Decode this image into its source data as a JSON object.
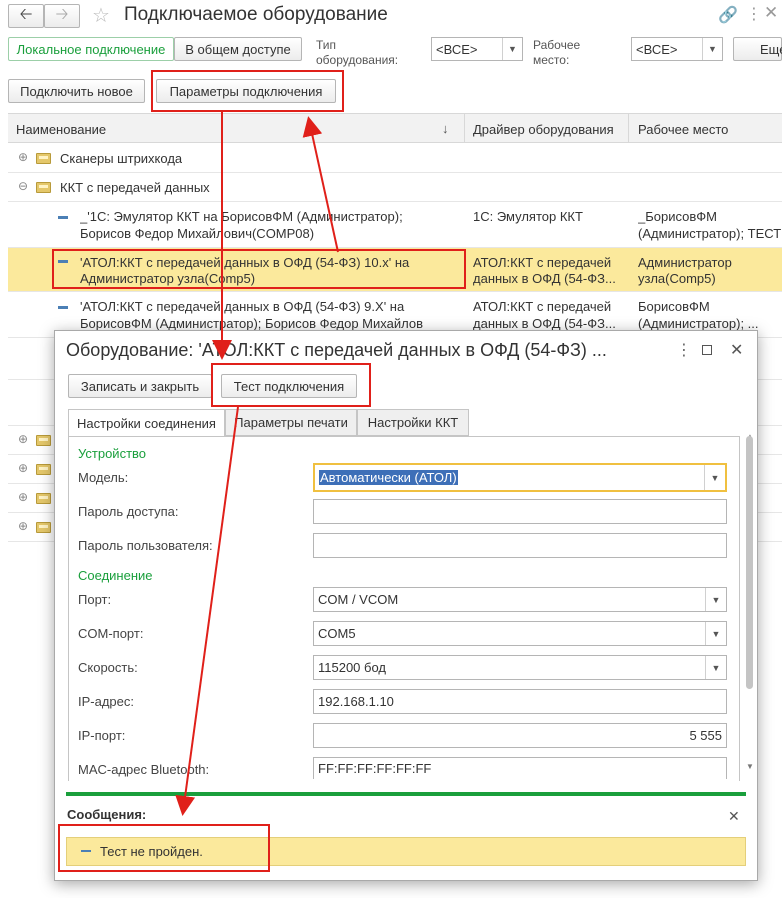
{
  "window": {
    "title": "Подключаемое оборудование"
  },
  "filters": {
    "local_label": "Локальное подключение",
    "shared_label": "В общем доступе",
    "equip_type_label": "Тип оборудования:",
    "equip_type_value": "<ВСЕ>",
    "workplace_label": "Рабочее место:",
    "workplace_value": "<ВСЕ>",
    "more_label": "Еще"
  },
  "toolbar": {
    "connect_new": "Подключить новое",
    "conn_params": "Параметры подключения"
  },
  "grid": {
    "columns": [
      "Наименование",
      "Драйвер оборудования",
      "Рабочее место"
    ],
    "sort_indicator": "↓",
    "groups": [
      {
        "label": "Сканеры штрихкода"
      },
      {
        "label": "ККТ с передачей данных"
      }
    ],
    "rows": [
      {
        "name1": "_'1С: Эмулятор ККТ на БорисовФМ (Администратор);",
        "name2": "Борисов Федор Михайлович(COMP08)",
        "driver1": "1С: Эмулятор ККТ",
        "driver2": "",
        "wp1": "_БорисовФМ",
        "wp2": "(Администратор); ТЕСТ"
      },
      {
        "name1": "'АТОЛ:ККТ с передачей данных в ОФД (54-ФЗ) 10.x' на",
        "name2": "Администратор узла(Comp5)",
        "driver1": "АТОЛ:ККТ с передачей",
        "driver2": "данных в ОФД (54-ФЗ...",
        "wp1": "Администратор",
        "wp2": "узла(Comp5)"
      },
      {
        "name1": "'АТОЛ:ККТ с передачей данных в ОФД (54-ФЗ) 9.X' на",
        "name2": "БорисовФМ (Администратор); Борисов Федор Михайлов",
        "driver1": "АТОЛ:ККТ с передачей",
        "driver2": "данных в ОФД (54-ФЗ...",
        "wp1": "БорисовФМ",
        "wp2": "(Администратор); ..."
      }
    ]
  },
  "dialog": {
    "title": "Оборудование: 'АТОЛ:ККТ с передачей данных в ОФД (54-ФЗ) ...",
    "save_close": "Записать и закрыть",
    "test_conn": "Тест подключения",
    "tabs": [
      "Настройки соединения",
      "Параметры печати",
      "Настройки ККТ"
    ],
    "section_device": "Устройство",
    "section_conn": "Соединение",
    "fields": {
      "model_label": "Модель:",
      "model_value": "Автоматически (АТОЛ)",
      "access_pw_label": "Пароль доступа:",
      "access_pw_value": "",
      "user_pw_label": "Пароль пользователя:",
      "user_pw_value": "",
      "port_label": "Порт:",
      "port_value": "COM / VCOM",
      "com_label": "COM-порт:",
      "com_value": "COM5",
      "speed_label": "Скорость:",
      "speed_value": "115200 бод",
      "ip_label": "IP-адрес:",
      "ip_value": "192.168.1.10",
      "ipport_label": "IP-порт:",
      "ipport_value": "5 555",
      "mac_label": "MAC-адрес Bluetooth:",
      "mac_value": "FF:FF:FF:FF:FF:FF"
    },
    "messages_title": "Сообщения:",
    "message_text": "Тест не пройден."
  },
  "colors": {
    "accent_green": "#1a9f3c",
    "highlight_yellow": "#fbe99c",
    "annotation_red": "#e0201a"
  }
}
